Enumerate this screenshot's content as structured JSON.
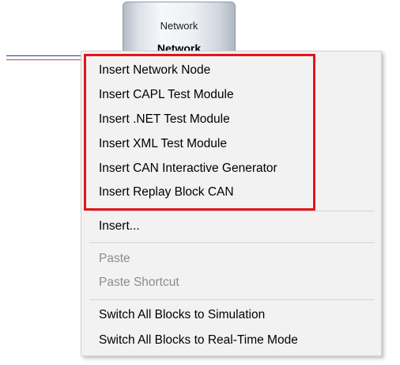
{
  "network_block": {
    "line1": "Network",
    "line2": "Network"
  },
  "context_menu": {
    "insert_items": [
      {
        "label": "Insert Network Node"
      },
      {
        "label": "Insert CAPL Test Module"
      },
      {
        "label": "Insert .NET Test Module"
      },
      {
        "label": "Insert XML Test Module"
      },
      {
        "label": "Insert CAN Interactive Generator"
      },
      {
        "label": "Insert Replay Block CAN"
      }
    ],
    "insert_more": "Insert...",
    "paste": "Paste",
    "paste_shortcut": "Paste Shortcut",
    "switch_simulation": "Switch All Blocks to Simulation",
    "switch_realtime": "Switch All Blocks to Real-Time Mode",
    "disabled_items": [
      "Paste",
      "Paste Shortcut"
    ]
  },
  "colors": {
    "highlight_border": "#e3141d",
    "menu_background": "#f2f2f2",
    "disabled_text": "#8d8d8d"
  }
}
